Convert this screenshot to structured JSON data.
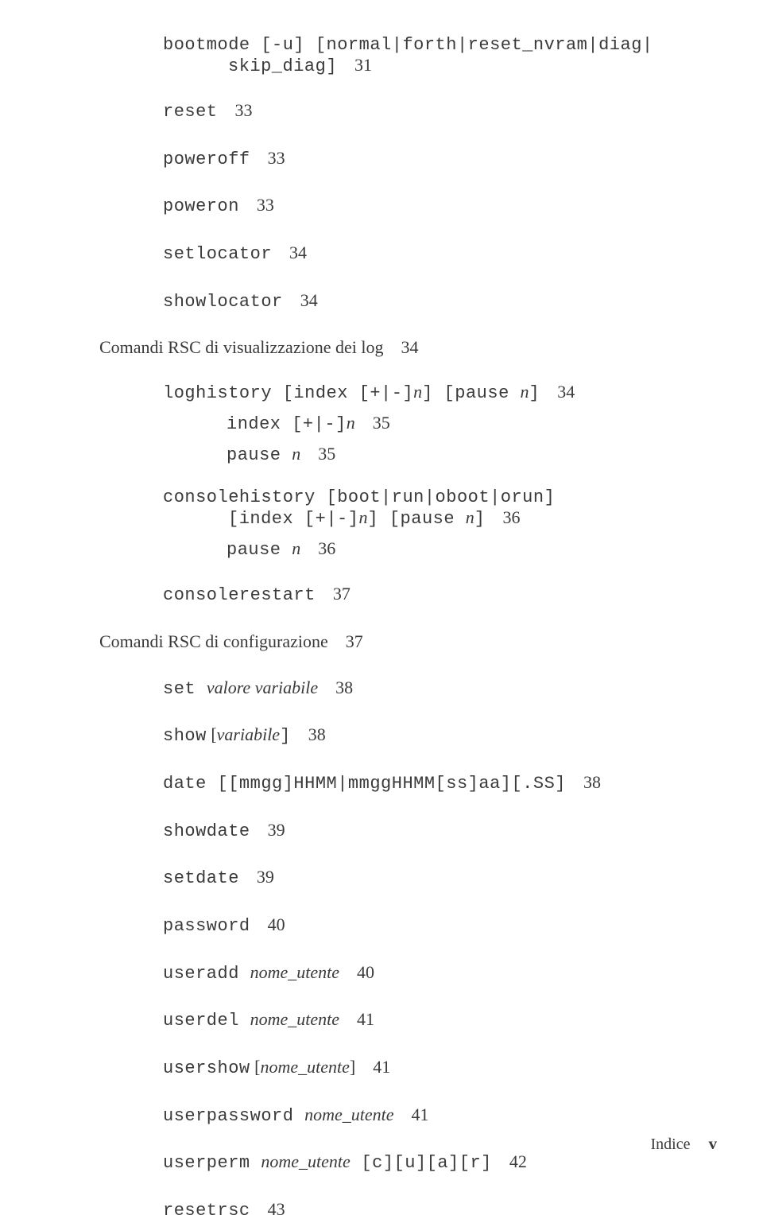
{
  "entries": {
    "bootmode": {
      "line1": "bootmode [-u] [normal|forth|reset_nvram|diag|",
      "line2": "skip_diag]",
      "page": "31"
    },
    "reset": {
      "text": "reset",
      "page": "33"
    },
    "poweroff": {
      "text": "poweroff",
      "page": "33"
    },
    "poweron": {
      "text": "poweron",
      "page": "33"
    },
    "setlocator": {
      "text": "setlocator",
      "page": "34"
    },
    "showlocator": {
      "text": "showlocator",
      "page": "34"
    },
    "section_log": {
      "text": "Comandi RSC di visualizzazione dei log",
      "page": "34"
    },
    "loghistory": {
      "prefix": "loghistory [index [+|-]",
      "n1": "n",
      "mid": "] [pause ",
      "n2": "n",
      "suffix": "]",
      "page": "34"
    },
    "index": {
      "prefix": "index [+|-]",
      "n": "n",
      "page": "35"
    },
    "pause1": {
      "prefix": "pause ",
      "n": "n",
      "page": "35"
    },
    "consolehistory": {
      "line1": "consolehistory [boot|run|oboot|orun]",
      "line2a": "[index [+|-]",
      "line2n1": "n",
      "line2b": "] [pause ",
      "line2n2": "n",
      "line2c": "]",
      "page": "36"
    },
    "pause2": {
      "prefix": "pause ",
      "n": "n",
      "page": "36"
    },
    "consolerestart": {
      "text": "consolerestart",
      "page": "37"
    },
    "section_config": {
      "text": "Comandi RSC di configurazione",
      "page": "37"
    },
    "set": {
      "prefix": "set ",
      "args": "valore variabile",
      "page": "38"
    },
    "show": {
      "prefix": "show",
      "lbrak": " [",
      "args": "variabile",
      "rbrak": "]",
      "page": "38"
    },
    "date": {
      "text": "date [[mmgg]HHMM|mmggHHMM[ss]aa][.SS]",
      "page": "38"
    },
    "showdate": {
      "text": "showdate",
      "page": "39"
    },
    "setdate": {
      "text": "setdate",
      "page": "39"
    },
    "password": {
      "text": "password",
      "page": "40"
    },
    "useradd": {
      "prefix": "useradd ",
      "args": "nome_utente",
      "page": "40"
    },
    "userdel": {
      "prefix": "userdel ",
      "args": "nome_utente",
      "page": "41"
    },
    "usershow": {
      "prefix": "usershow",
      "lbrak": " [",
      "args": "nome_utente",
      "rbrak": "]",
      "page": "41"
    },
    "userpassword": {
      "prefix": "userpassword ",
      "args": "nome_utente",
      "page": "41"
    },
    "userperm": {
      "prefix": "userperm ",
      "args": "nome_utente",
      "suffix": " [c][u][a][r]",
      "page": "42"
    },
    "resetrsc": {
      "text": "resetrsc",
      "page": "43"
    }
  },
  "footer": {
    "label": "Indice",
    "page": "v"
  }
}
